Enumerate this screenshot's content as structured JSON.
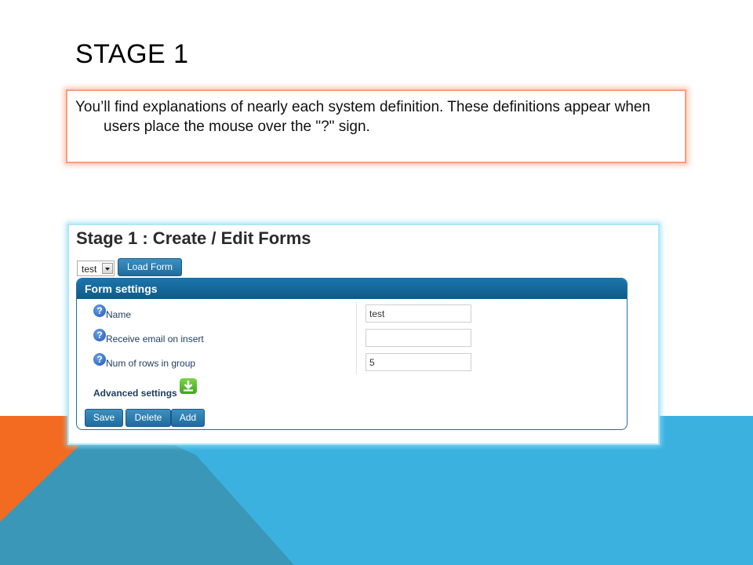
{
  "slide": {
    "title": "STAGE 1",
    "description": "You’ll find explanations of nearly each system definition. These definitions appear when users place the mouse over the \"?\" sign."
  },
  "app": {
    "title": "Stage 1 : Create / Edit Forms",
    "form_select": {
      "value": "test"
    },
    "load_button": "Load Form",
    "panel": {
      "header": "Form settings",
      "help_symbol": "?",
      "fields": [
        {
          "label": "Name",
          "value": "test"
        },
        {
          "label": "Receive email on insert",
          "value": ""
        },
        {
          "label": "Num of rows in group",
          "value": "5"
        }
      ],
      "advanced_label": "Advanced settings",
      "advanced_icon": "download-icon"
    },
    "actions": {
      "save": "Save",
      "delete": "Delete",
      "add": "Add"
    }
  },
  "colors": {
    "accent_orange": "#f26b21",
    "accent_blue": "#3bb1e0",
    "button_blue": "#1f6c9e",
    "help_icon_blue": "#1f55b8",
    "download_icon_green": "#3fa51c"
  }
}
